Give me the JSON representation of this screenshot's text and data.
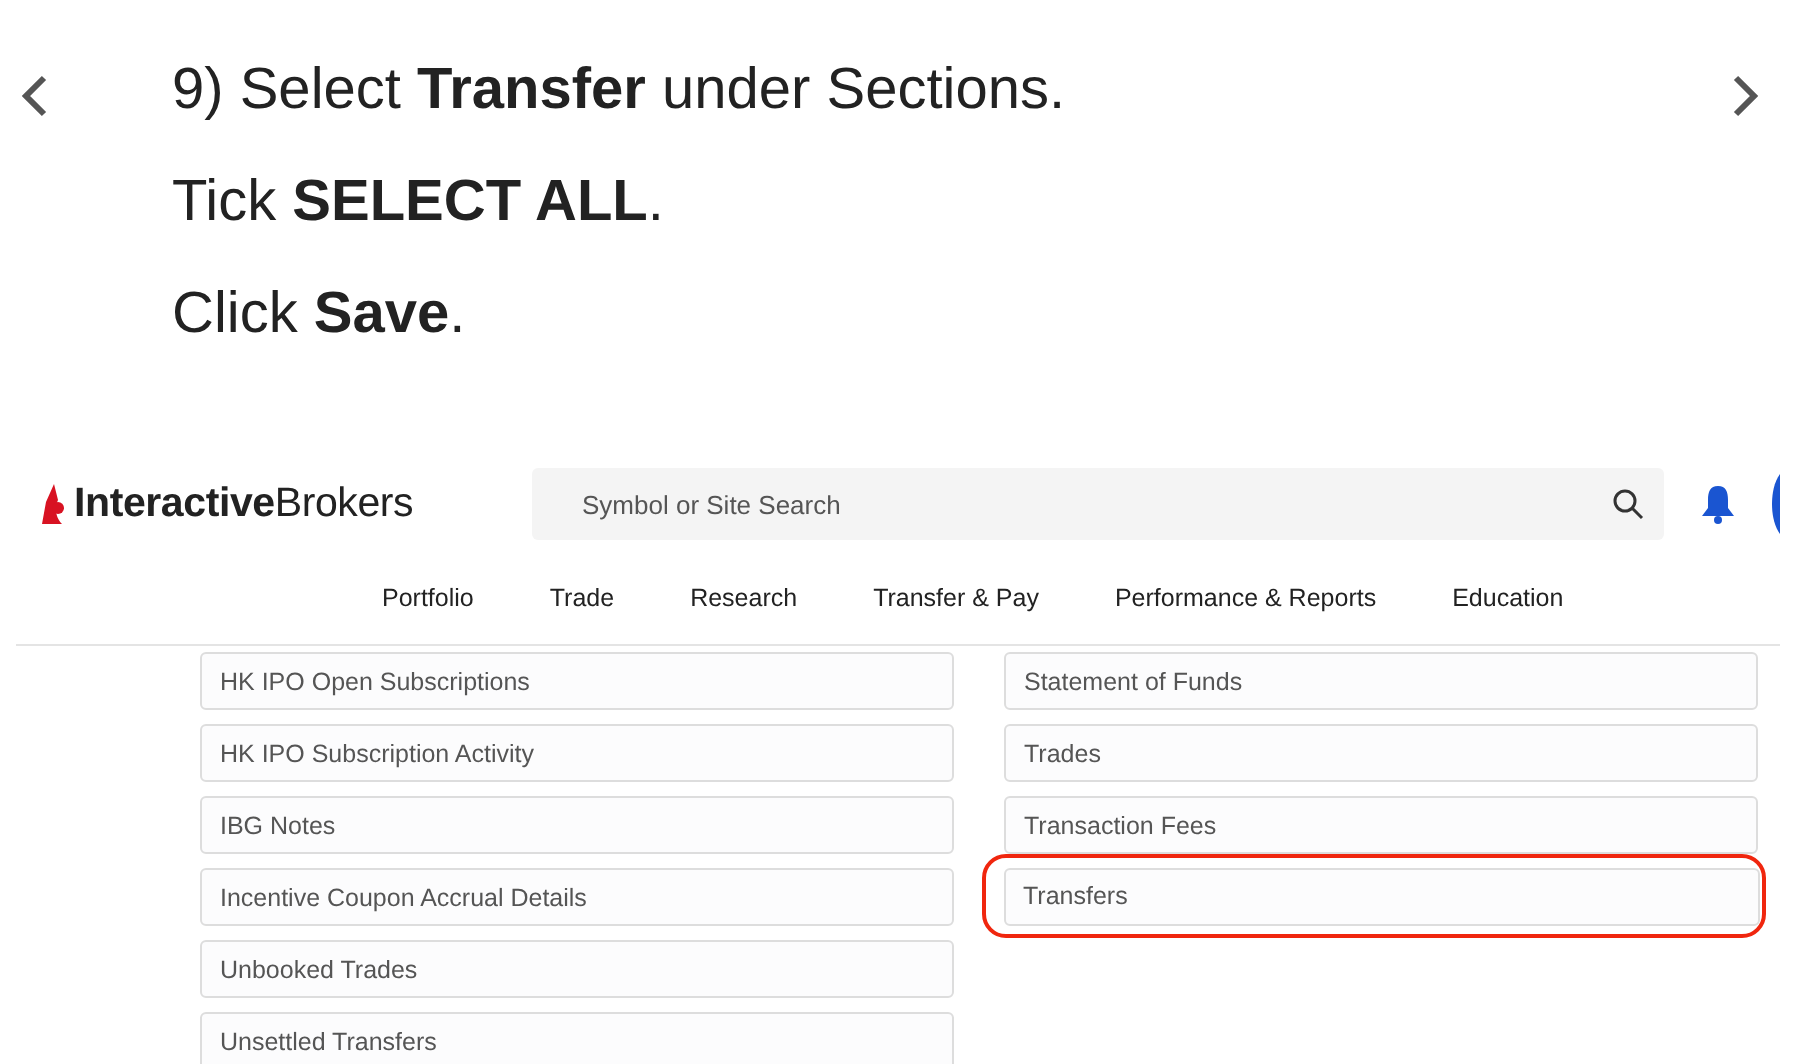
{
  "instructions": [
    "9) Select **Transfer** under Sections.",
    "Tick **SELECT ALL**.",
    "Click **Save**."
  ],
  "header": {
    "logo": "**Interactive**Brokers",
    "search": {
      "placeholder": "Symbol or Site Search"
    }
  },
  "nav": [
    "Portfolio",
    "Trade",
    "Research",
    "Transfer & Pay",
    "Performance & Reports",
    "Education"
  ],
  "sections": [
    {
      "items": [
        {
          "label": "HK IPO Open Subscriptions",
          "highlighted": false
        },
        {
          "label": "HK IPO Subscription Activity",
          "highlighted": false
        },
        {
          "label": "IBG Notes",
          "highlighted": false
        },
        {
          "label": "Incentive Coupon Accrual Details",
          "highlighted": false
        },
        {
          "label": "Unbooked Trades",
          "highlighted": false
        },
        {
          "label": "Unsettled Transfers",
          "highlighted": false
        }
      ]
    },
    {
      "items": [
        {
          "label": "Statement of Funds",
          "highlighted": false
        },
        {
          "label": "Trades",
          "highlighted": false
        },
        {
          "label": "Transaction Fees",
          "highlighted": false
        },
        {
          "label": "Transfers",
          "highlighted": true
        }
      ]
    }
  ]
}
